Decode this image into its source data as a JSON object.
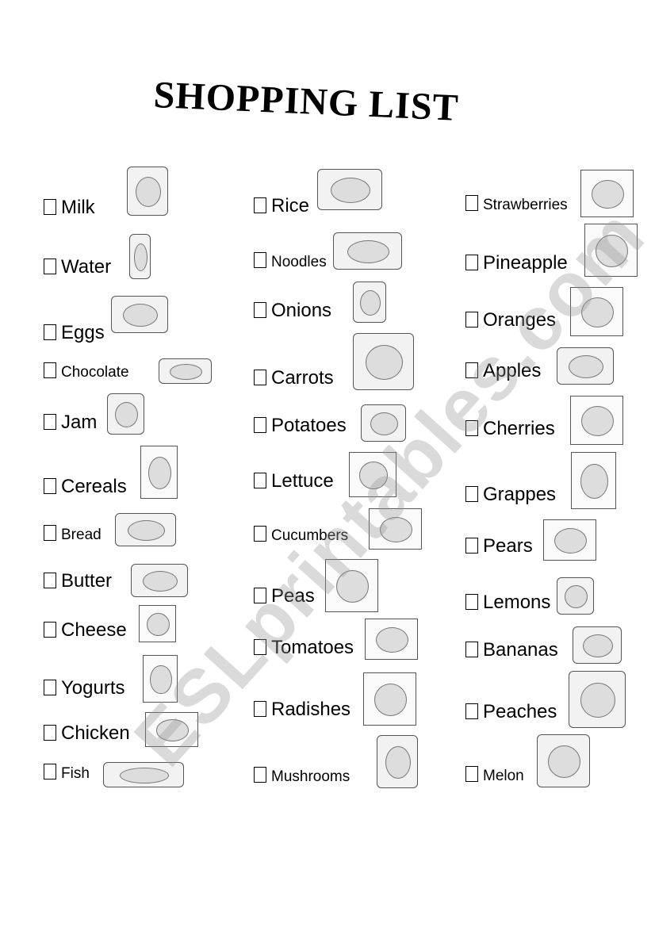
{
  "title": "SHOPPING LIST",
  "watermark": "ESLprintables.com",
  "columns": [
    {
      "items": [
        "Milk",
        "Water",
        "Eggs",
        "Chocolate",
        "Jam",
        "Cereals",
        "Bread",
        "Butter",
        "Cheese",
        "Yogurts",
        "Chicken",
        "Fish"
      ]
    },
    {
      "items": [
        "Rice",
        "Noodles",
        "Onions",
        "Carrots",
        "Potatoes",
        "Lettuce",
        "Cucumbers",
        "Peas",
        "Tomatoes",
        "Radishes",
        "Mushrooms"
      ]
    },
    {
      "items": [
        "Strawberries",
        "Pineapple",
        "Oranges",
        "Apples",
        "Cherries",
        "Grappes",
        "Pears",
        "Lemons",
        "Bananas",
        "Peaches",
        "Melon"
      ]
    }
  ]
}
